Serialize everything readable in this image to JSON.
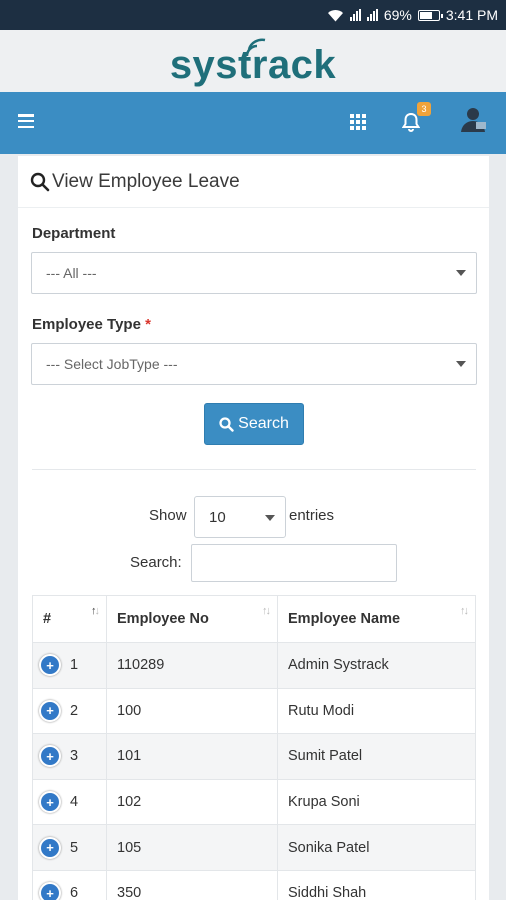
{
  "status_bar": {
    "battery": "69%",
    "time": "3:41 PM"
  },
  "app": {
    "logo_text": "systrack"
  },
  "navbar": {
    "menu_icon": "hamburger-icon",
    "apps_icon": "grid-icon",
    "notification_icon": "bell-icon",
    "notification_count": "3"
  },
  "page": {
    "title": "View Employee Leave"
  },
  "form": {
    "department_label": "Department",
    "department_value": "--- All ---",
    "employee_type_label": "Employee Type",
    "required_mark": "*",
    "employee_type_value": "--- Select JobType ---",
    "search_button": "Search"
  },
  "table_controls": {
    "show_label": "Show",
    "entries_value": "10",
    "entries_label": "entries",
    "search_label": "Search:",
    "search_value": ""
  },
  "table": {
    "columns": [
      "#",
      "Employee No",
      "Employee Name"
    ],
    "rows": [
      {
        "index": "1",
        "employee_no": "110289",
        "employee_name": "Admin Systrack"
      },
      {
        "index": "2",
        "employee_no": "100",
        "employee_name": "Rutu Modi"
      },
      {
        "index": "3",
        "employee_no": "101",
        "employee_name": "Sumit Patel"
      },
      {
        "index": "4",
        "employee_no": "102",
        "employee_name": "Krupa Soni"
      },
      {
        "index": "5",
        "employee_no": "105",
        "employee_name": "Sonika Patel"
      },
      {
        "index": "6",
        "employee_no": "350",
        "employee_name": "Siddhi Shah"
      }
    ]
  },
  "colors": {
    "navbar": "#3b8dc3",
    "status_bar": "#1d2f42",
    "logo": "#1f6f7a",
    "badge": "#f0a33a",
    "expand_button": "#3279c7"
  }
}
